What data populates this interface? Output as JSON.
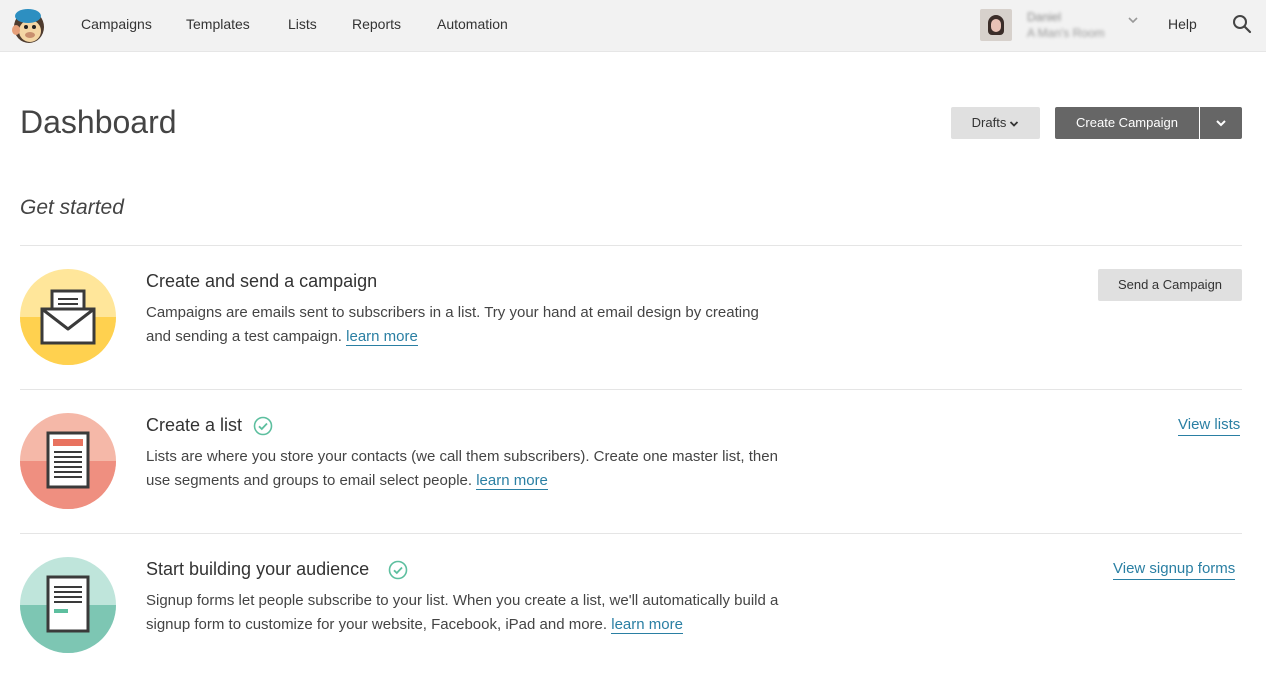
{
  "nav": {
    "items": [
      "Campaigns",
      "Templates",
      "Lists",
      "Reports",
      "Automation"
    ],
    "help": "Help",
    "profile": {
      "name": "Daniel",
      "org": "A Man's Room"
    }
  },
  "header": {
    "title": "Dashboard",
    "drafts_label": "Drafts",
    "create_label": "Create Campaign"
  },
  "get_started": {
    "title": "Get started",
    "cards": [
      {
        "title": "Create and send a campaign",
        "desc": "Campaigns are emails sent to subscribers in a list. Try your hand at email design by creating and sending a test campaign.",
        "learn": "learn more",
        "action": "Send a Campaign",
        "completed": false,
        "icon": "envelope-icon",
        "color": "#ffd85c"
      },
      {
        "title": "Create a list",
        "desc": "Lists are where you store your contacts (we call them subscribers). Create one master list, then use segments and groups to email select people.",
        "learn": "learn more",
        "action": "View lists",
        "completed": true,
        "icon": "list-document-icon",
        "color": "#f0968a"
      },
      {
        "title": "Start building your audience",
        "desc": "Signup forms let people subscribe to your list. When you create a list, we'll automatically build a signup form to customize for your website, Facebook, iPad and more.",
        "learn": "learn more",
        "action": "View signup forms",
        "completed": true,
        "icon": "signup-form-icon",
        "color": "#7dc6b3"
      }
    ]
  },
  "colors": {
    "accent_link": "#2a7fa3",
    "check_green": "#5dbf9f",
    "button_dark": "#666666",
    "button_light": "#e0e0e0"
  }
}
